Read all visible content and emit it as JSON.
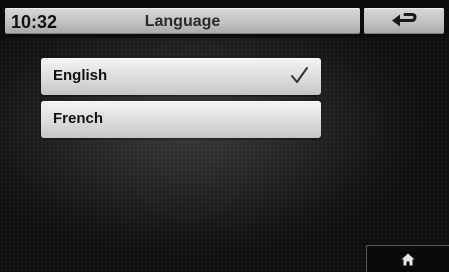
{
  "header": {
    "time": "10:32",
    "title": "Language",
    "back_icon": "back-arrow-icon"
  },
  "languages": [
    {
      "label": "English",
      "selected": true
    },
    {
      "label": "French",
      "selected": false
    }
  ],
  "footer": {
    "home_icon": "home-icon"
  }
}
